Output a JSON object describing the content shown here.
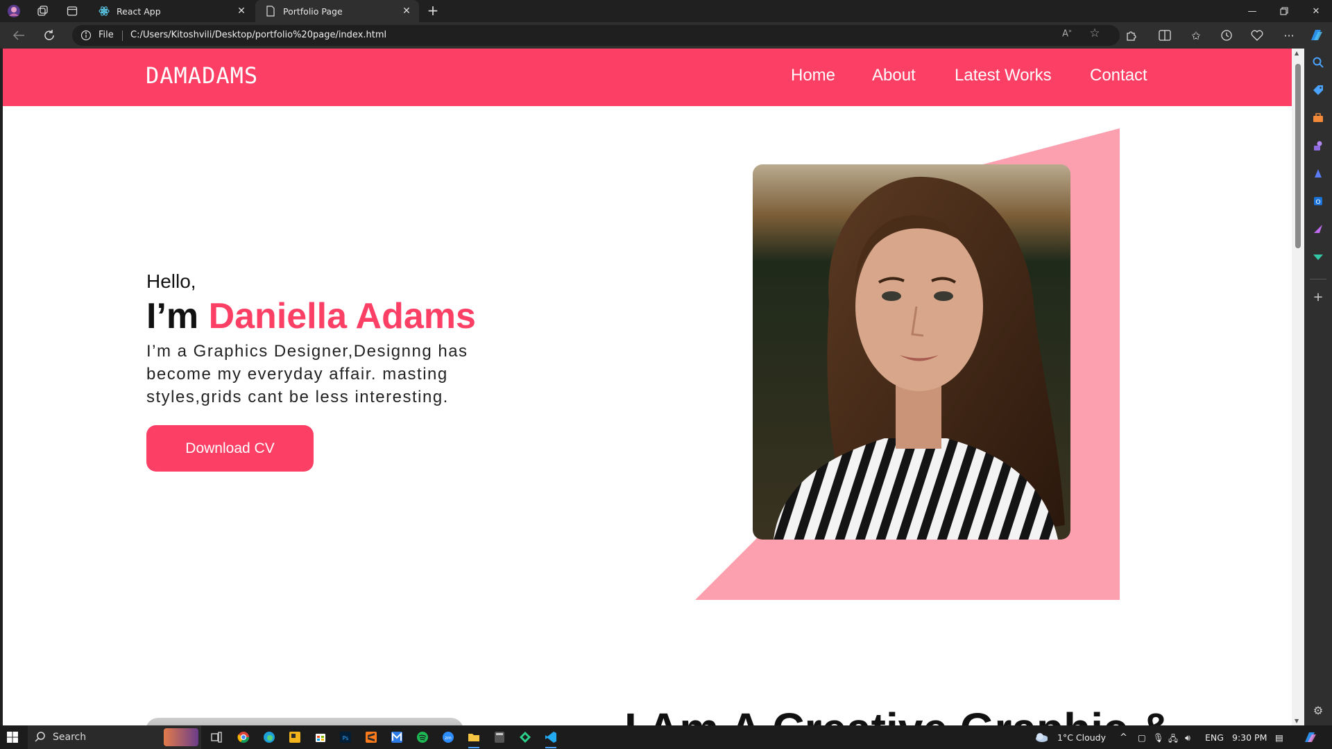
{
  "browser": {
    "tabs": [
      {
        "label": "React App",
        "active": false
      },
      {
        "label": "Portfolio Page",
        "active": true
      }
    ],
    "address": {
      "scheme_label": "File",
      "url": "C:/Users/Kitoshvili/Desktop/portfolio%20page/index.html"
    }
  },
  "site": {
    "logo": "DAMADAMS",
    "nav": [
      "Home",
      "About",
      "Latest Works",
      "Contact"
    ],
    "hero": {
      "greeting": "Hello,",
      "intro_prefix": "I’m ",
      "name": "Daniella Adams",
      "description": "I’m a Graphics Designer,Designng has become my everyday affair. masting styles,grids cant be less interesting.",
      "cta": "Download CV"
    },
    "next_section_title": "I Am A Creative Graphic &"
  },
  "taskbar": {
    "search_label": "Search",
    "weather": "1°C  Cloudy",
    "language": "ENG",
    "time": "9:30 PM"
  },
  "colors": {
    "accent": "#fb3f65",
    "frame_pink": "#fca0b0",
    "browser_dark": "#202020"
  }
}
